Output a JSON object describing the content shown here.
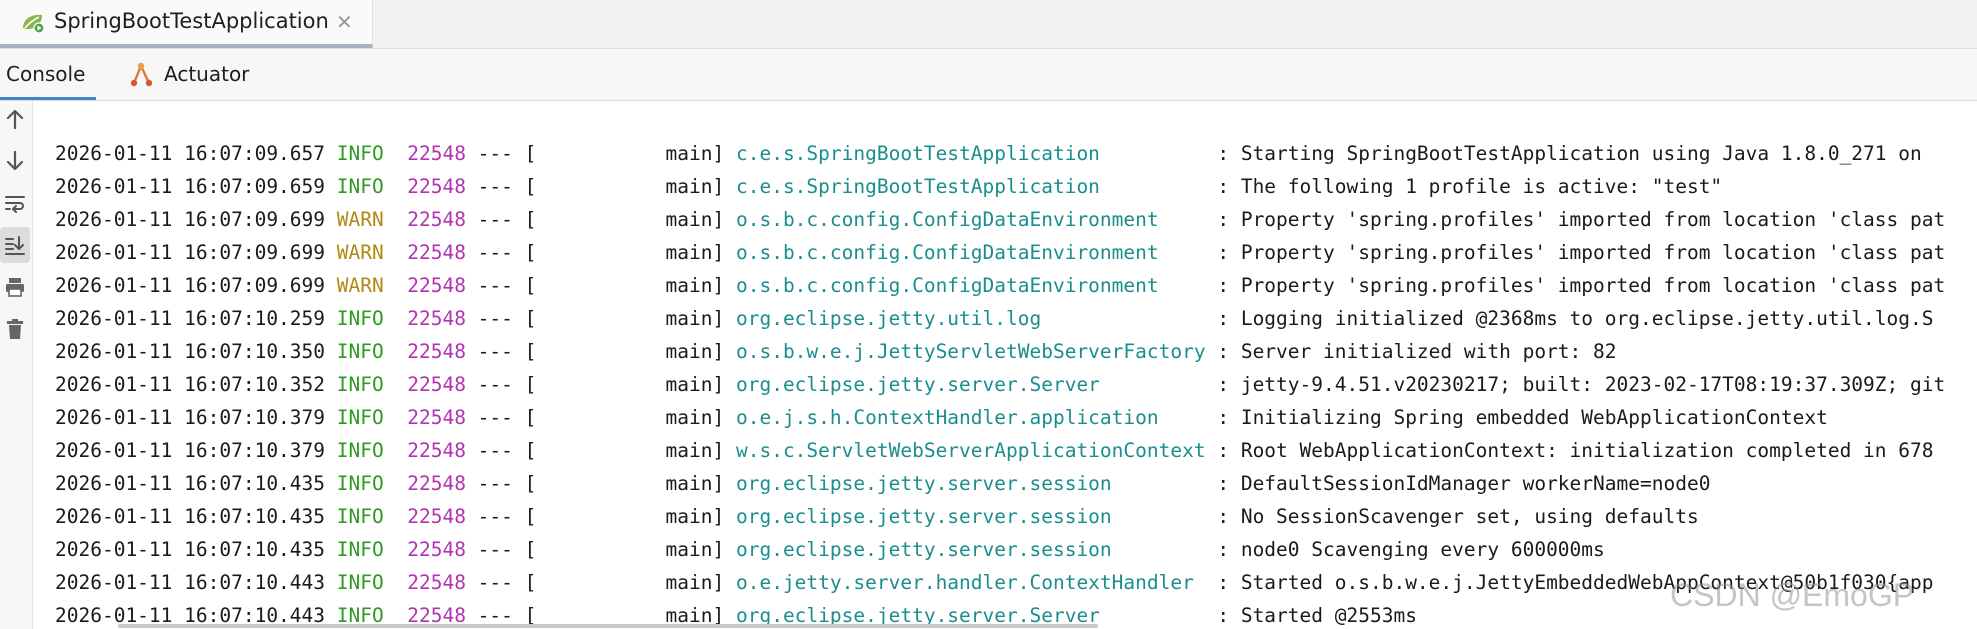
{
  "run_tab": {
    "label": "SpringBootTestApplication",
    "close": "✕",
    "icon": "spring-boot-run-icon"
  },
  "tool_tabs": {
    "console": "Console",
    "actuator": "Actuator"
  },
  "side_toolbar": [
    {
      "icon": "scroll-up-arrow-icon"
    },
    {
      "icon": "scroll-down-arrow-icon"
    },
    {
      "icon": "soft-wrap-icon"
    },
    {
      "icon": "scroll-to-end-icon",
      "active": true
    },
    {
      "icon": "print-icon"
    },
    {
      "icon": "trash-icon"
    }
  ],
  "log": [
    {
      "timestamp": "2026-01-11 16:07:09.657",
      "level": "INFO",
      "pid": "22548",
      "thread": "main",
      "logger": "c.e.s.SpringBootTestApplication",
      "message": "Starting SpringBootTestApplication using Java 1.8.0_271 on"
    },
    {
      "timestamp": "2026-01-11 16:07:09.659",
      "level": "INFO",
      "pid": "22548",
      "thread": "main",
      "logger": "c.e.s.SpringBootTestApplication",
      "message": "The following 1 profile is active: \"test\""
    },
    {
      "timestamp": "2026-01-11 16:07:09.699",
      "level": "WARN",
      "pid": "22548",
      "thread": "main",
      "logger": "o.s.b.c.config.ConfigDataEnvironment",
      "message": "Property 'spring.profiles' imported from location 'class pat"
    },
    {
      "timestamp": "2026-01-11 16:07:09.699",
      "level": "WARN",
      "pid": "22548",
      "thread": "main",
      "logger": "o.s.b.c.config.ConfigDataEnvironment",
      "message": "Property 'spring.profiles' imported from location 'class pat"
    },
    {
      "timestamp": "2026-01-11 16:07:09.699",
      "level": "WARN",
      "pid": "22548",
      "thread": "main",
      "logger": "o.s.b.c.config.ConfigDataEnvironment",
      "message": "Property 'spring.profiles' imported from location 'class pat"
    },
    {
      "timestamp": "2026-01-11 16:07:10.259",
      "level": "INFO",
      "pid": "22548",
      "thread": "main",
      "logger": "org.eclipse.jetty.util.log",
      "message": "Logging initialized @2368ms to org.eclipse.jetty.util.log.S"
    },
    {
      "timestamp": "2026-01-11 16:07:10.350",
      "level": "INFO",
      "pid": "22548",
      "thread": "main",
      "logger": "o.s.b.w.e.j.JettyServletWebServerFactory",
      "message": "Server initialized with port: 82"
    },
    {
      "timestamp": "2026-01-11 16:07:10.352",
      "level": "INFO",
      "pid": "22548",
      "thread": "main",
      "logger": "org.eclipse.jetty.server.Server",
      "message": "jetty-9.4.51.v20230217; built: 2023-02-17T08:19:37.309Z; git"
    },
    {
      "timestamp": "2026-01-11 16:07:10.379",
      "level": "INFO",
      "pid": "22548",
      "thread": "main",
      "logger": "o.e.j.s.h.ContextHandler.application",
      "message": "Initializing Spring embedded WebApplicationContext"
    },
    {
      "timestamp": "2026-01-11 16:07:10.379",
      "level": "INFO",
      "pid": "22548",
      "thread": "main",
      "logger": "w.s.c.ServletWebServerApplicationContext",
      "message": "Root WebApplicationContext: initialization completed in 678"
    },
    {
      "timestamp": "2026-01-11 16:07:10.435",
      "level": "INFO",
      "pid": "22548",
      "thread": "main",
      "logger": "org.eclipse.jetty.server.session",
      "message": "DefaultSessionIdManager workerName=node0"
    },
    {
      "timestamp": "2026-01-11 16:07:10.435",
      "level": "INFO",
      "pid": "22548",
      "thread": "main",
      "logger": "org.eclipse.jetty.server.session",
      "message": "No SessionScavenger set, using defaults"
    },
    {
      "timestamp": "2026-01-11 16:07:10.435",
      "level": "INFO",
      "pid": "22548",
      "thread": "main",
      "logger": "org.eclipse.jetty.server.session",
      "message": "node0 Scavenging every 600000ms"
    },
    {
      "timestamp": "2026-01-11 16:07:10.443",
      "level": "INFO",
      "pid": "22548",
      "thread": "main",
      "logger": "o.e.jetty.server.handler.ContextHandler",
      "message": "Started o.s.b.w.e.j.JettyEmbeddedWebAppContext@50b1f030{app"
    },
    {
      "timestamp": "2026-01-11 16:07:10.443",
      "level": "INFO",
      "pid": "22548",
      "thread": "main",
      "logger": "org.eclipse.jetty.server.Server",
      "message": "Started @2553ms"
    }
  ],
  "watermark": "CSDN @EmoGP",
  "colors": {
    "info": "#2f9a22",
    "warn": "#b18912",
    "pid": "#b233b2",
    "logger": "#1b8d8d",
    "accent": "#4083c9"
  }
}
